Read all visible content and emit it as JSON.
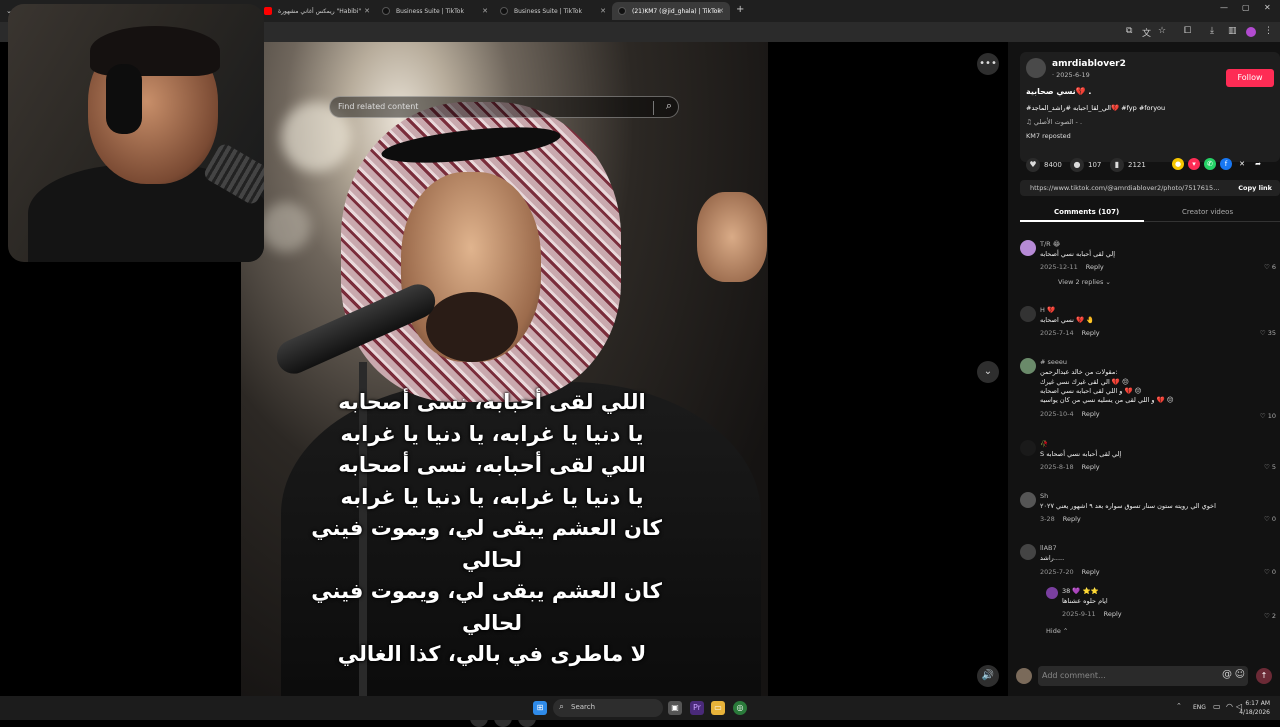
{
  "browser": {
    "tabs": [
      {
        "title": ""
      },
      {
        "title": "ريمكس أغاني مشهورة \"Habibi\""
      },
      {
        "title": "Business Suite | TikTok"
      },
      {
        "title": "Business Suite | TikTok"
      },
      {
        "title": "(21)KM7 (@jid_ghala) | TikTok"
      }
    ],
    "new_tab": "+"
  },
  "viewer": {
    "search_placeholder": "Find related content",
    "more_icon": "more-horizontal-icon",
    "scroll_down_icon": "chevron-down-icon",
    "volume_icon": "speaker-icon",
    "lyrics": [
      "اللي لقى أحبابه، نسى أصحابه",
      "يا دنيا يا غرابه، يا دنيا يا غرابه",
      "اللي لقى أحبابه، نسى أصحابه",
      "يا دنيا يا غرابه، يا دنيا يا غرابه",
      "كان العشم يبقى لي، ويموت فيني",
      "لحالي",
      "كان العشم يبقى لي، ويموت فيني",
      "لحالي",
      "لا ماطرى في بالي، كذا الغالي"
    ]
  },
  "author": {
    "username": "amrdiablover2",
    "date": "· 2025-6-19",
    "caption": "نسي صحابية💔 .",
    "tags": "#الي_لقا_احبابه #راشد_الماجد💔 #fyp #foryou",
    "sound": "♫ الصوت الأصلي - .",
    "reposted": "KM7 reposted",
    "follow_label": "Follow"
  },
  "stats": {
    "likes": "8400",
    "comments": "107",
    "saves": "2121"
  },
  "link": {
    "url": "https://www.tiktok.com/@amrdiablover2/photo/7517615...",
    "copy_label": "Copy link"
  },
  "panel_tabs": {
    "comments": "Comments (107)",
    "creator": "Creator videos"
  },
  "comments": [
    {
      "name": "T/R 😂",
      "text": "إلي لقى أحبابه نسي أصحابه",
      "date": "2025-12-11",
      "reply": "Reply",
      "likes": "6",
      "extra": "View 2 replies ⌄"
    },
    {
      "name": "H 💔",
      "text": "نسي اصحابه 💔 🤚",
      "date": "2025-7-14",
      "reply": "Reply",
      "likes": "35"
    },
    {
      "name": "# seeeu",
      "text": "مقولات من خالد عبدالرحمن:",
      "lines": [
        "الي لقى غيرك نسي غيرك 💔 😔",
        "و اللي لقى احبابه نسي اصحابه 💔 😔",
        "و اللي لقى من يسليه نسي من كان يواسيه 💔 😔"
      ],
      "date": "2025-10-4",
      "reply": "Reply",
      "likes": "10"
    },
    {
      "name": "🥀",
      "text": "S إلي لقى أحبابه نسي أصحابه",
      "date": "2025-8-18",
      "reply": "Reply",
      "likes": "5"
    },
    {
      "name": "Sh",
      "text": "اخوي الي رويته ستون سنار تسوق سواره بعد ٩ اشهور يعني ٢٠٢٧",
      "date": "3-28",
      "reply": "Reply",
      "likes": "0"
    },
    {
      "name": "llAB7",
      "text": "راشد.....",
      "date": "2025-7-20",
      "reply": "Reply",
      "likes": "0"
    },
    {
      "name": "38 💜 ⭐⭐",
      "text": "ايام حلوه عشناها",
      "date": "2025-9-11",
      "reply": "Reply",
      "likes": "2",
      "extra": "Hide ⌃"
    }
  ],
  "comment_input": {
    "placeholder": "Add comment...",
    "at_icon": "@"
  },
  "taskbar": {
    "search_label": "Search",
    "lang": "ENG",
    "time": "6:17 AM",
    "date": "4/18/2026"
  },
  "colors": {
    "follow": "#fe2c55",
    "panel_bg": "#121212"
  }
}
